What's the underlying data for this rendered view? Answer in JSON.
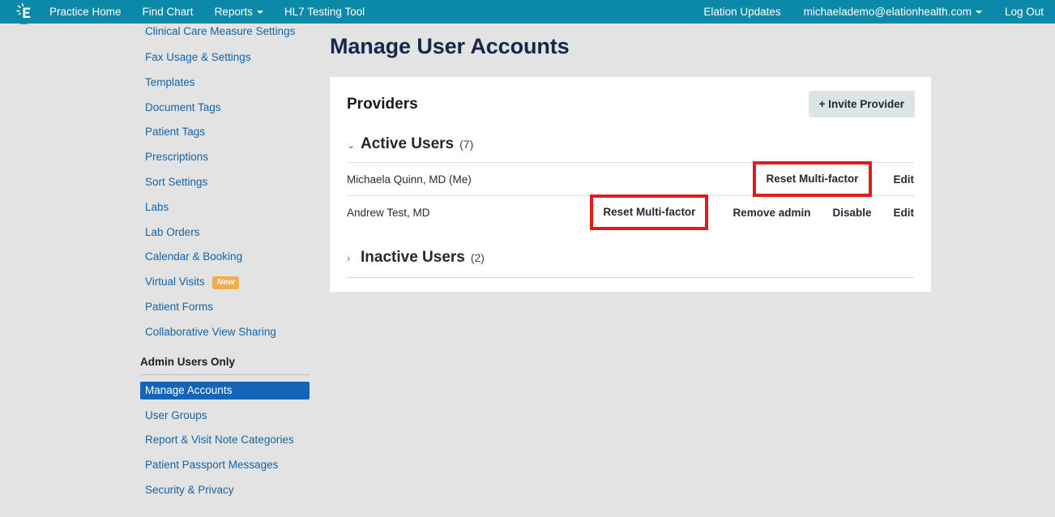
{
  "topnav": {
    "logo_icon": "elation-e-logo-icon",
    "left_items": [
      {
        "label": "Practice Home",
        "name": "nav-practice-home",
        "caret": false
      },
      {
        "label": "Find Chart",
        "name": "nav-find-chart",
        "caret": false
      },
      {
        "label": "Reports",
        "name": "nav-reports",
        "caret": true
      },
      {
        "label": "HL7 Testing Tool",
        "name": "nav-hl7-testing-tool",
        "caret": false
      }
    ],
    "right_items": [
      {
        "label": "Elation Updates",
        "name": "nav-elation-updates",
        "caret": false
      },
      {
        "label": "michaelademo@elationhealth.com",
        "name": "nav-user-account",
        "caret": true
      },
      {
        "label": "Log Out",
        "name": "nav-log-out",
        "caret": false
      }
    ],
    "background_color": "#0c89a8"
  },
  "sidebar": {
    "items": [
      {
        "label": "Clinical Care Measure Settings",
        "badge": ""
      },
      {
        "label": "Fax Usage & Settings",
        "badge": ""
      },
      {
        "label": "Templates",
        "badge": ""
      },
      {
        "label": "Document Tags",
        "badge": ""
      },
      {
        "label": "Patient Tags",
        "badge": ""
      },
      {
        "label": "Prescriptions",
        "badge": ""
      },
      {
        "label": "Sort Settings",
        "badge": ""
      },
      {
        "label": "Labs",
        "badge": ""
      },
      {
        "label": "Lab Orders",
        "badge": ""
      },
      {
        "label": "Calendar & Booking",
        "badge": ""
      },
      {
        "label": "Virtual Visits",
        "badge": "New"
      },
      {
        "label": "Patient Forms",
        "badge": ""
      },
      {
        "label": "Collaborative View Sharing",
        "badge": ""
      }
    ],
    "admin_section": {
      "heading": "Admin Users Only",
      "items": [
        {
          "label": "Manage Accounts",
          "active": true
        },
        {
          "label": "User Groups",
          "active": false
        },
        {
          "label": "Report & Visit Note Categories",
          "active": false
        },
        {
          "label": "Patient Passport Messages",
          "active": false
        },
        {
          "label": "Security & Privacy",
          "active": false
        }
      ],
      "active_color": "#1465b7"
    },
    "link_color": "#1464a5"
  },
  "main": {
    "page_title": "Manage User Accounts",
    "card": {
      "title": "Providers",
      "invite_button": "+ Invite Provider",
      "groups": [
        {
          "name": "active-users",
          "chevron": "chevron-down-icon",
          "chevron_glyph": "⌄",
          "title": "Active Users",
          "count": "(7)",
          "expanded": true,
          "rows": [
            {
              "name": "Michaela Quinn, MD (Me)",
              "actions": [
                {
                  "label": "Reset Multi-factor",
                  "highlighted": true
                },
                {
                  "label": "Edit",
                  "highlighted": false
                }
              ]
            },
            {
              "name": "Andrew Test, MD",
              "actions": [
                {
                  "label": "Reset Multi-factor",
                  "highlighted": true
                },
                {
                  "label": "Remove admin",
                  "highlighted": false
                },
                {
                  "label": "Disable",
                  "highlighted": false
                },
                {
                  "label": "Edit",
                  "highlighted": false
                }
              ]
            }
          ]
        },
        {
          "name": "inactive-users",
          "chevron": "chevron-right-icon",
          "chevron_glyph": "›",
          "title": "Inactive Users",
          "count": "(2)",
          "expanded": false,
          "rows": []
        }
      ]
    },
    "annotation_color": "#e21b1b"
  }
}
